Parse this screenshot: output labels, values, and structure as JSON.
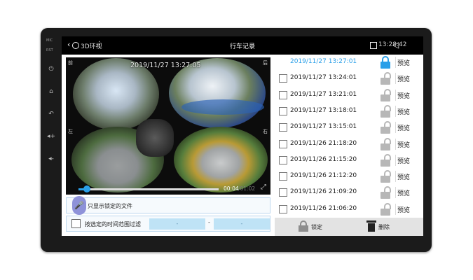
{
  "topbar": {
    "mode_label": "3D环视",
    "title": "行车记录",
    "clock": "13:28:42"
  },
  "video": {
    "overlay_timestamp": "2019/11/27 13:27:05",
    "corner_front": "前",
    "corner_rear": "后",
    "corner_left": "左",
    "corner_right": "右",
    "current_time": "00:04",
    "total_time": "/01:02",
    "progress_fraction": 0.06
  },
  "filters": {
    "locked_only_label": "只显示锁定的文件",
    "time_range_label": "按选定的时间范围过滤",
    "date_from": "-",
    "date_to": "-",
    "range_separator": "-"
  },
  "files": [
    {
      "time": "2019/11/27 13:27:01",
      "locked": true,
      "active": true,
      "preview": "预览"
    },
    {
      "time": "2019/11/27 13:24:01",
      "locked": false,
      "active": false,
      "preview": "预览"
    },
    {
      "time": "2019/11/27 13:21:01",
      "locked": false,
      "active": false,
      "preview": "预览"
    },
    {
      "time": "2019/11/27 13:18:01",
      "locked": false,
      "active": false,
      "preview": "预览"
    },
    {
      "time": "2019/11/27 13:15:01",
      "locked": false,
      "active": false,
      "preview": "预览"
    },
    {
      "time": "2019/11/26 21:18:20",
      "locked": false,
      "active": false,
      "preview": "预览"
    },
    {
      "time": "2019/11/26 21:15:20",
      "locked": false,
      "active": false,
      "preview": "预览"
    },
    {
      "time": "2019/11/26 21:12:20",
      "locked": false,
      "active": false,
      "preview": "预览"
    },
    {
      "time": "2019/11/26 21:09:20",
      "locked": false,
      "active": false,
      "preview": "预览"
    },
    {
      "time": "2019/11/26 21:06:20",
      "locked": false,
      "active": false,
      "preview": "预览"
    }
  ],
  "bottom_bar": {
    "lock_label": "锁定",
    "delete_label": "删除"
  },
  "device": {
    "side_labels": [
      "MIC",
      "RST"
    ]
  },
  "colors": {
    "accent": "#2a9fe8",
    "mic_button": "#8e92d9",
    "date_box": "#bfe3f6",
    "bottom_bar": "#e3e3e3"
  }
}
